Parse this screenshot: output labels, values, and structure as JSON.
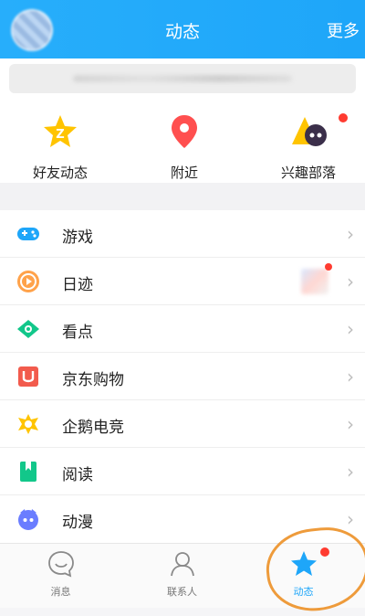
{
  "header": {
    "title": "动态",
    "more_label": "更多"
  },
  "quick": [
    {
      "label": "好友动态",
      "icon": "friend-star-icon"
    },
    {
      "label": "附近",
      "icon": "location-pin-icon"
    },
    {
      "label": "兴趣部落",
      "icon": "tribe-icon",
      "has_badge": true
    }
  ],
  "list": [
    {
      "label": "游戏",
      "icon": "gamepad-icon"
    },
    {
      "label": "日迹",
      "icon": "camera-record-icon",
      "has_thumb": true
    },
    {
      "label": "看点",
      "icon": "eye-icon"
    },
    {
      "label": "京东购物",
      "icon": "jd-u-icon"
    },
    {
      "label": "企鹅电竞",
      "icon": "esports-icon"
    },
    {
      "label": "阅读",
      "icon": "bookmark-icon"
    },
    {
      "label": "动漫",
      "icon": "anime-icon"
    }
  ],
  "tabs": [
    {
      "label": "消息",
      "icon": "message-smile-icon"
    },
    {
      "label": "联系人",
      "icon": "contacts-icon"
    },
    {
      "label": "动态",
      "icon": "star-icon",
      "active": true
    }
  ],
  "colors": {
    "accent": "#1ea6f9",
    "badge": "#ff3b30",
    "annotation": "#ee9b3b"
  }
}
